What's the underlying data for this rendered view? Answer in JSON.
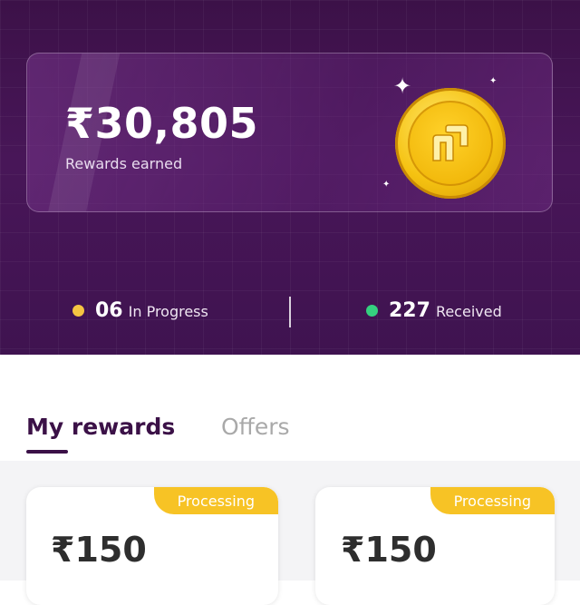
{
  "summary": {
    "total_amount": "₹30,805",
    "caption": "Rewards earned"
  },
  "stats": {
    "in_progress": {
      "count": "06",
      "label": "In Progress",
      "dot_color": "#f5c542"
    },
    "received": {
      "count": "227",
      "label": "Received",
      "dot_color": "#35d07f"
    }
  },
  "tabs": [
    {
      "label": "My rewards",
      "active": true
    },
    {
      "label": "Offers",
      "active": false
    }
  ],
  "rewards": [
    {
      "amount": "₹150",
      "status": "Processing"
    },
    {
      "amount": "₹150",
      "status": "Processing"
    }
  ],
  "colors": {
    "header_bg": "#481658",
    "accent": "#3b1147",
    "badge": "#f7c325",
    "coin": "#f5c211"
  },
  "icons": {
    "coin": "reward-coin-icon",
    "sparkle": "sparkle-icon"
  }
}
